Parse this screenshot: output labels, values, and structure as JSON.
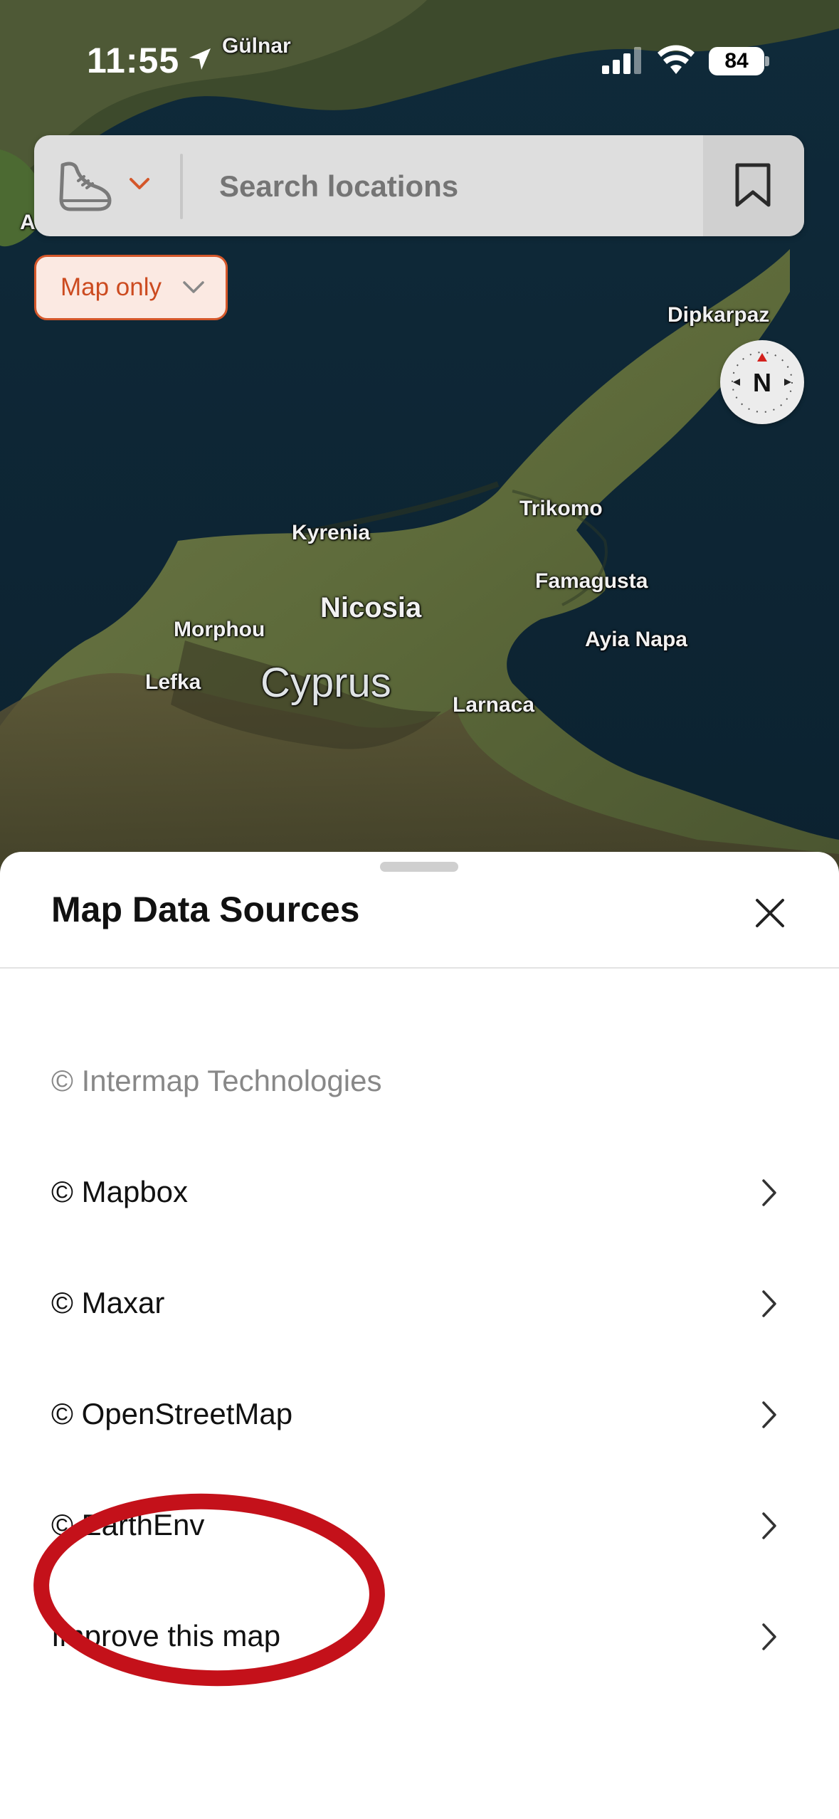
{
  "status_bar": {
    "time": "11:55",
    "battery": "84"
  },
  "map": {
    "places": [
      {
        "name": "Gülnar",
        "size": "small"
      },
      {
        "name": "A",
        "size": "small"
      },
      {
        "name": "Dipkarpaz",
        "size": "small"
      },
      {
        "name": "Trikomo",
        "size": "small"
      },
      {
        "name": "Kyrenia",
        "size": "small"
      },
      {
        "name": "Famagusta",
        "size": "small"
      },
      {
        "name": "Nicosia",
        "size": "big"
      },
      {
        "name": "Morphou",
        "size": "small"
      },
      {
        "name": "Ayia Napa",
        "size": "small"
      },
      {
        "name": "Lefka",
        "size": "small"
      },
      {
        "name": "Cyprus",
        "size": "country"
      },
      {
        "name": "Larnaca",
        "size": "small"
      }
    ]
  },
  "search": {
    "placeholder": "Search locations"
  },
  "filter": {
    "label": "Map only"
  },
  "compass": {
    "label": "N"
  },
  "sheet": {
    "title": "Map Data Sources",
    "rows": [
      {
        "label": "© Intermap Technologies",
        "enabled": false
      },
      {
        "label": "© Mapbox",
        "enabled": true
      },
      {
        "label": "© Maxar",
        "enabled": true
      },
      {
        "label": "© OpenStreetMap",
        "enabled": true
      },
      {
        "label": "© EarthEnv",
        "enabled": true
      },
      {
        "label": "Improve this map",
        "enabled": true
      }
    ]
  },
  "colors": {
    "accent": "#d4572a",
    "annotation": "#c4111a"
  }
}
